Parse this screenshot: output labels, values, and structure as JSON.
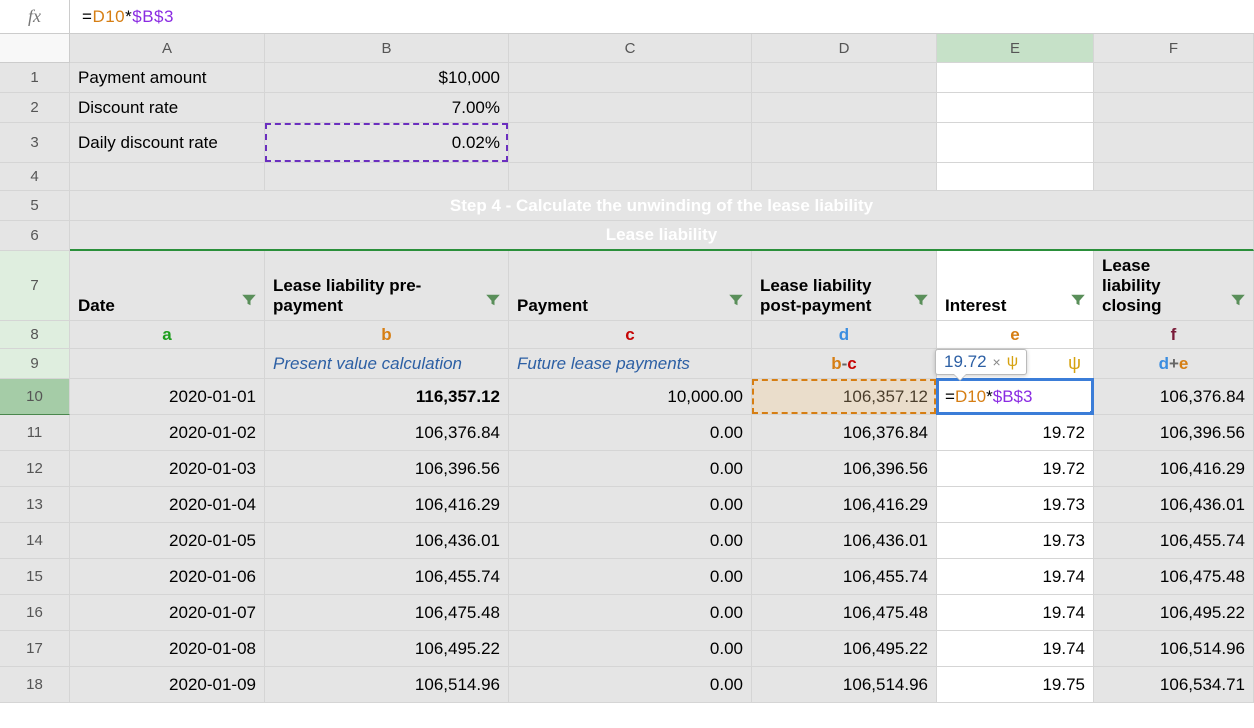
{
  "formula_bar": {
    "eq": "=",
    "ref1": "D10",
    "op": "*",
    "ref2": "$B$3"
  },
  "cols": [
    "A",
    "B",
    "C",
    "D",
    "E",
    "F"
  ],
  "rows": [
    "1",
    "2",
    "3",
    "4",
    "5",
    "6",
    "7",
    "8",
    "9",
    "10",
    "11",
    "12",
    "13",
    "14",
    "15",
    "16",
    "17",
    "18"
  ],
  "header_rows": {
    "r1": {
      "A": "Payment amount",
      "B": "$10,000"
    },
    "r2": {
      "A": "Discount rate",
      "B": "7.00%"
    },
    "r3": {
      "A": "Daily discount rate",
      "B": "0.02%"
    }
  },
  "step4_title": "Step 4 - Calculate the unwinding of the lease liability",
  "lease_liability_title": "Lease liability",
  "col_headers7": {
    "A": "Date",
    "B": "Lease liability pre-payment",
    "C": "Payment",
    "D": "Lease liability post-payment",
    "E": "Interest",
    "F": "Lease liability closing"
  },
  "letters8": {
    "A": "a",
    "B": "b",
    "C": "c",
    "D": "d",
    "E": "e",
    "F": "f"
  },
  "row9": {
    "B": "Present value calculation",
    "C": "Future lease payments",
    "D_b": "b",
    "D_op": " - ",
    "D_c": "c",
    "E_psi": "ψ",
    "F_d": "d",
    "F_op": " + ",
    "F_e": "e"
  },
  "tooltip": {
    "value": "19.72",
    "close": "×",
    "psi": "ψ"
  },
  "e10_formula": {
    "eq": "=",
    "ref1": "D10",
    "op": "*",
    "ref2": "$B$3"
  },
  "data_rows": [
    {
      "date": "2020-01-01",
      "b": "116,357.12",
      "c": "10,000.00",
      "d": "106,357.12",
      "e_formula": true,
      "f": "106,376.84"
    },
    {
      "date": "2020-01-02",
      "b": "106,376.84",
      "c": "0.00",
      "d": "106,376.84",
      "e": "19.72",
      "f": "106,396.56"
    },
    {
      "date": "2020-01-03",
      "b": "106,396.56",
      "c": "0.00",
      "d": "106,396.56",
      "e": "19.72",
      "f": "106,416.29"
    },
    {
      "date": "2020-01-04",
      "b": "106,416.29",
      "c": "0.00",
      "d": "106,416.29",
      "e": "19.73",
      "f": "106,436.01"
    },
    {
      "date": "2020-01-05",
      "b": "106,436.01",
      "c": "0.00",
      "d": "106,436.01",
      "e": "19.73",
      "f": "106,455.74"
    },
    {
      "date": "2020-01-06",
      "b": "106,455.74",
      "c": "0.00",
      "d": "106,455.74",
      "e": "19.74",
      "f": "106,475.48"
    },
    {
      "date": "2020-01-07",
      "b": "106,475.48",
      "c": "0.00",
      "d": "106,475.48",
      "e": "19.74",
      "f": "106,495.22"
    },
    {
      "date": "2020-01-08",
      "b": "106,495.22",
      "c": "0.00",
      "d": "106,495.22",
      "e": "19.74",
      "f": "106,514.96"
    },
    {
      "date": "2020-01-09",
      "b": "106,514.96",
      "c": "0.00",
      "d": "106,514.96",
      "e": "19.75",
      "f": "106,534.71"
    }
  ],
  "chart_data": {
    "type": "table",
    "title": "Lease liability unwinding schedule",
    "columns": [
      "Date",
      "Lease liability pre-payment",
      "Payment",
      "Lease liability post-payment",
      "Interest",
      "Lease liability closing"
    ],
    "rows": [
      [
        "2020-01-01",
        116357.12,
        10000.0,
        106357.12,
        19.72,
        106376.84
      ],
      [
        "2020-01-02",
        106376.84,
        0.0,
        106376.84,
        19.72,
        106396.56
      ],
      [
        "2020-01-03",
        106396.56,
        0.0,
        106396.56,
        19.72,
        106416.29
      ],
      [
        "2020-01-04",
        106416.29,
        0.0,
        106416.29,
        19.73,
        106436.01
      ],
      [
        "2020-01-05",
        106436.01,
        0.0,
        106436.01,
        19.73,
        106455.74
      ],
      [
        "2020-01-06",
        106455.74,
        0.0,
        106455.74,
        19.74,
        106475.48
      ],
      [
        "2020-01-07",
        106475.48,
        0.0,
        106475.48,
        19.74,
        106495.22
      ],
      [
        "2020-01-08",
        106495.22,
        0.0,
        106495.22,
        19.74,
        106514.96
      ],
      [
        "2020-01-09",
        106514.96,
        0.0,
        106514.96,
        19.75,
        106534.71
      ]
    ],
    "parameters": {
      "payment_amount": 10000,
      "discount_rate": 0.07,
      "daily_discount_rate": 0.0002
    }
  }
}
